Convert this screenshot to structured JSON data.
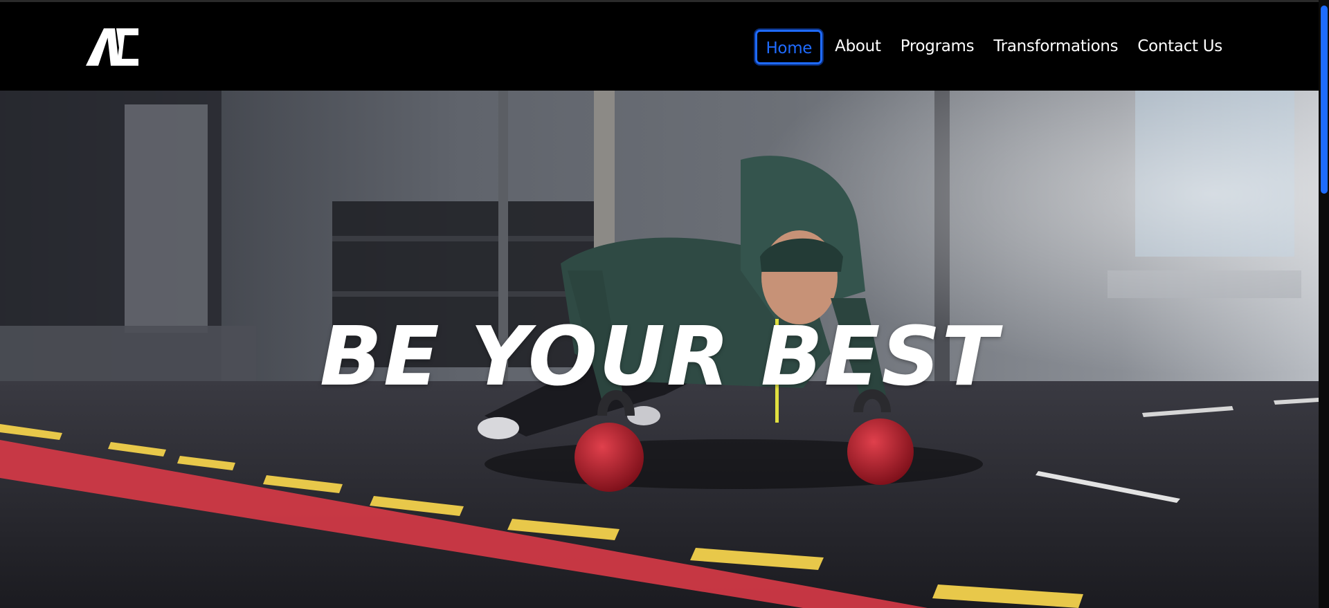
{
  "brand": {
    "logo_text": "AC"
  },
  "nav": {
    "items": [
      {
        "label": "Home",
        "active": true
      },
      {
        "label": "About",
        "active": false
      },
      {
        "label": "Programs",
        "active": false
      },
      {
        "label": "Transformations",
        "active": false
      },
      {
        "label": "Contact Us",
        "active": false
      }
    ]
  },
  "hero": {
    "headline": "BE YOUR BEST",
    "image": "woman-pushup-on-kettlebells-in-gym"
  },
  "colors": {
    "accent": "#1f6bff",
    "nav_bg": "#000000",
    "text": "#ffffff"
  }
}
